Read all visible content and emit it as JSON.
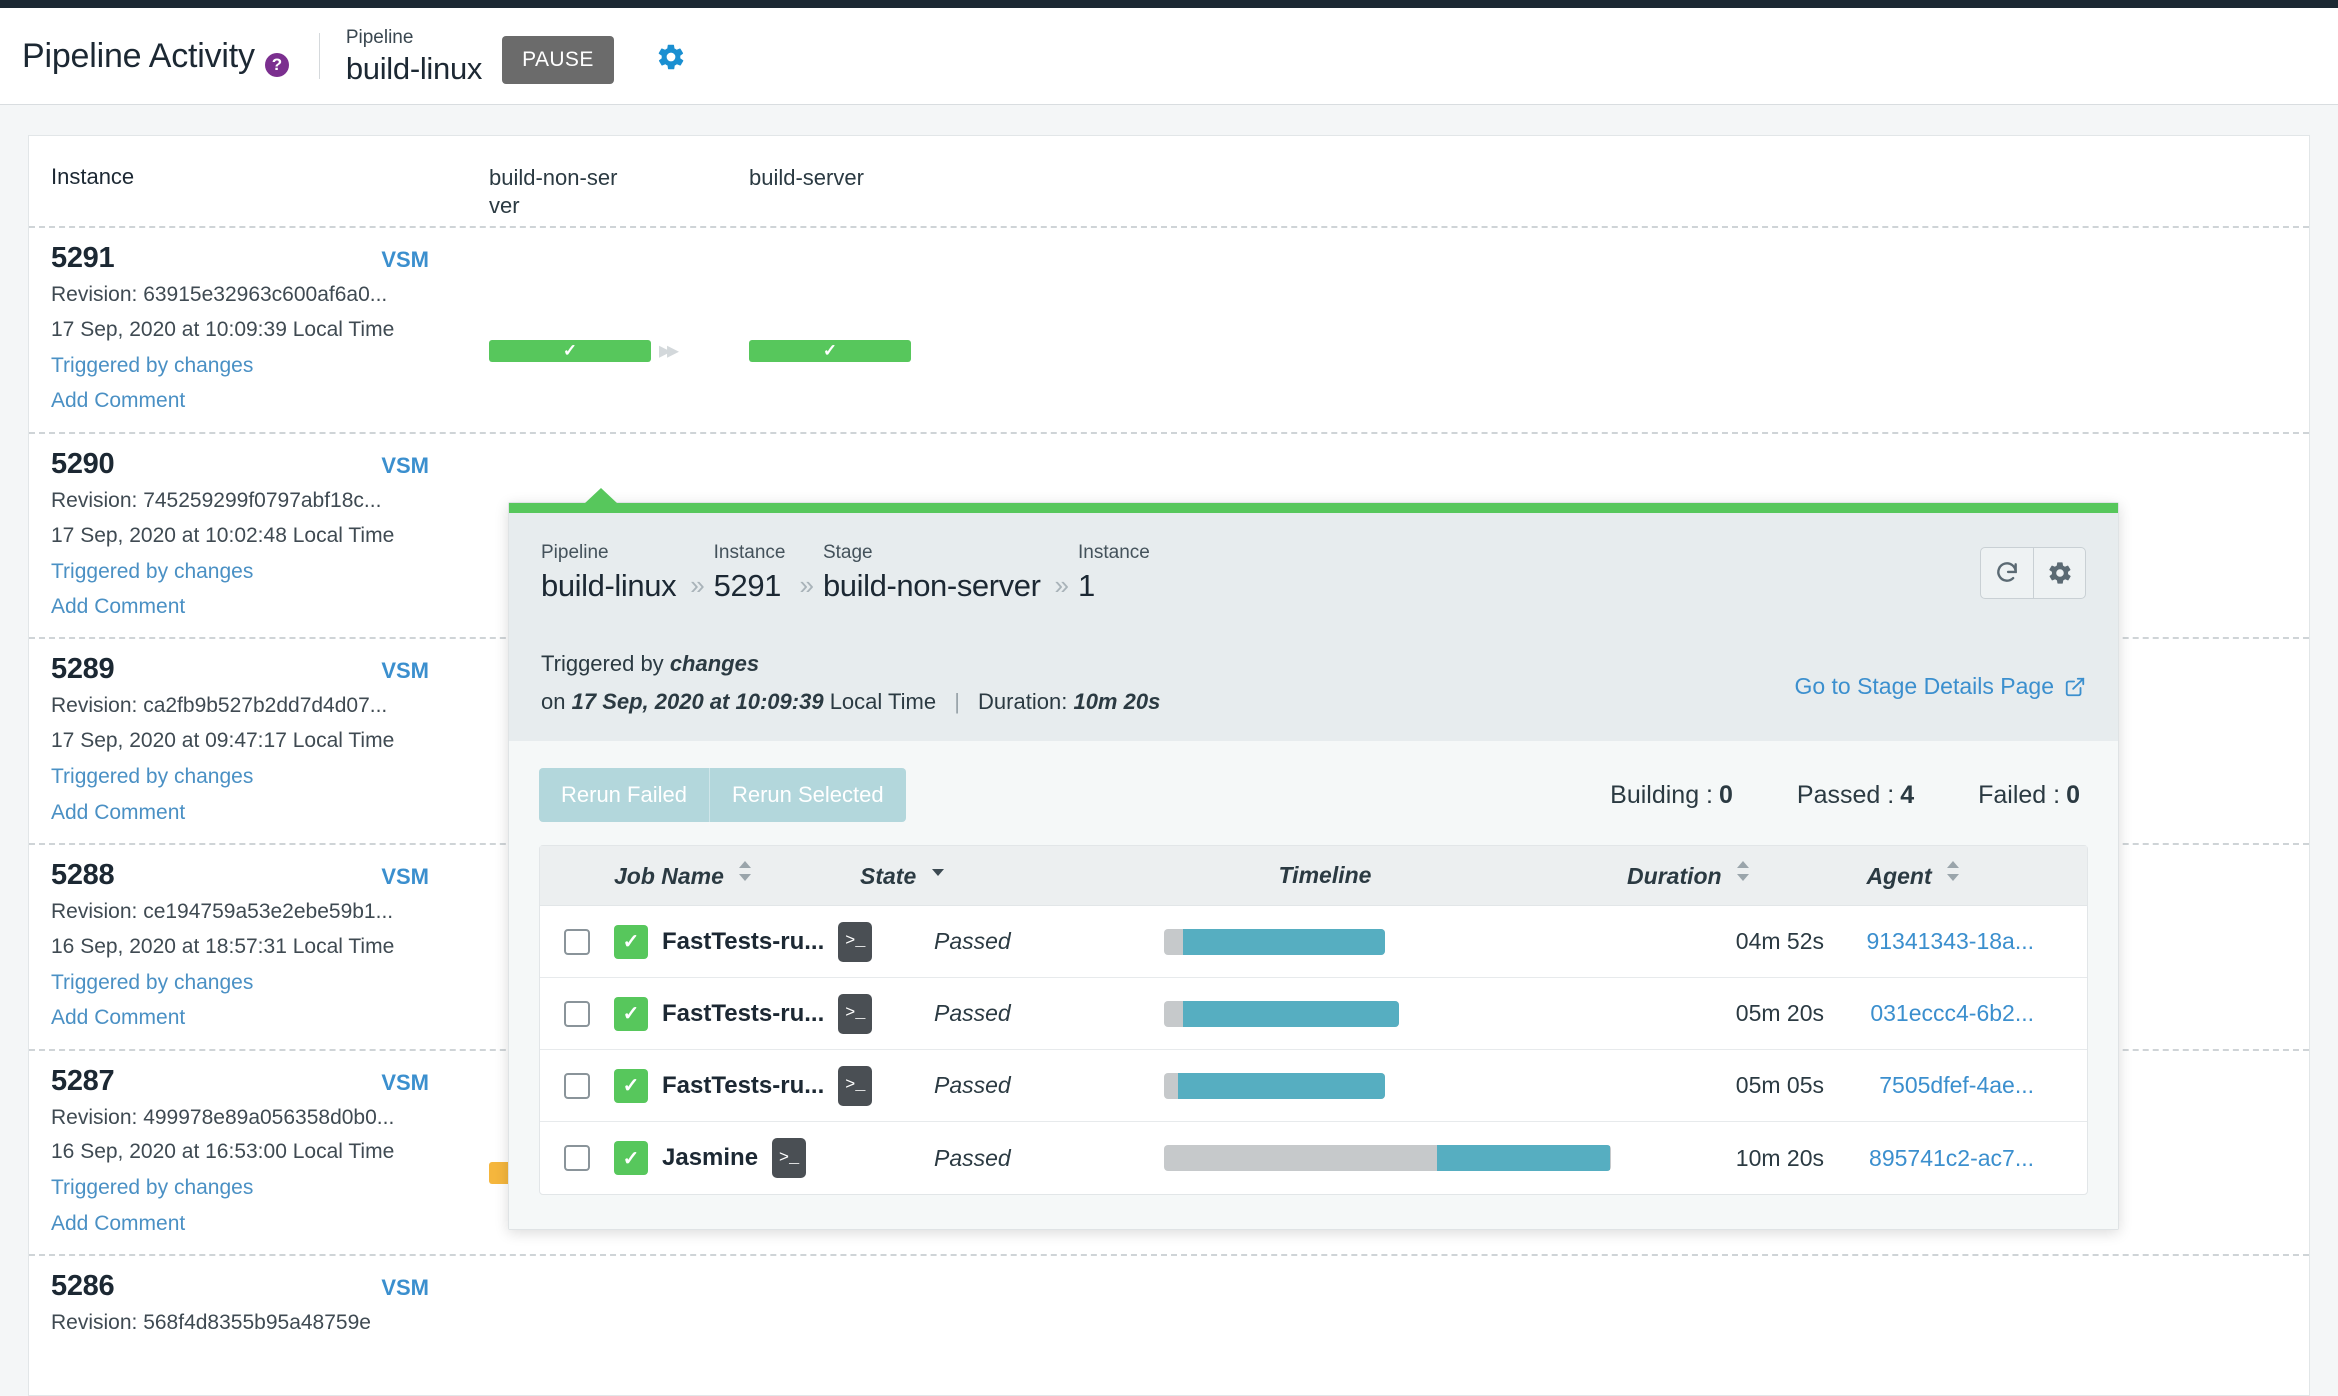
{
  "header": {
    "title": "Pipeline Activity",
    "help_icon": "help-icon",
    "pipeline_label": "Pipeline",
    "pipeline_name": "build-linux",
    "pause_label": "PAUSE",
    "gear_icon": "gear-icon"
  },
  "grid": {
    "instance_column": "Instance",
    "stages": [
      "build-non-ser\nver",
      "build-server"
    ]
  },
  "instances": [
    {
      "id": "5291",
      "vsm": "VSM",
      "revision": "Revision: 63915e32963c600af6a0...",
      "timestamp": "17 Sep, 2020 at 10:09:39 Local Time",
      "triggered": "Triggered by changes",
      "comment": "Add Comment",
      "stages": [
        {
          "name": "build-non-server",
          "status": "passed"
        },
        {
          "name": "build-server",
          "status": "passed"
        }
      ]
    },
    {
      "id": "5290",
      "vsm": "VSM",
      "revision": "Revision: 745259299f0797abf18c...",
      "timestamp": "17 Sep, 2020 at 10:02:48 Local Time",
      "triggered": "Triggered by changes",
      "comment": "Add Comment",
      "stages": []
    },
    {
      "id": "5289",
      "vsm": "VSM",
      "revision": "Revision: ca2fb9b527b2dd7d4d07...",
      "timestamp": "17 Sep, 2020 at 09:47:17 Local Time",
      "triggered": "Triggered by changes",
      "comment": "Add Comment",
      "stages": []
    },
    {
      "id": "5288",
      "vsm": "VSM",
      "revision": "Revision: ce194759a53e2ebe59b1...",
      "timestamp": "16 Sep, 2020 at 18:57:31 Local Time",
      "triggered": "Triggered by changes",
      "comment": "Add Comment",
      "stages": []
    },
    {
      "id": "5287",
      "vsm": "VSM",
      "revision": "Revision: 499978e89a056358d0b0...",
      "timestamp": "16 Sep, 2020 at 16:53:00 Local Time",
      "triggered": "Triggered by changes",
      "comment": "Add Comment",
      "stages": [
        {
          "name": "build-non-server",
          "status": "warning"
        }
      ]
    },
    {
      "id": "5286",
      "vsm": "VSM",
      "revision": "Revision: 568f4d8355b95a48759e",
      "timestamp": "",
      "triggered": "",
      "comment": "",
      "stages": []
    }
  ],
  "popup": {
    "breadcrumb": [
      {
        "label": "Pipeline",
        "value": "build-linux"
      },
      {
        "label": "Instance",
        "value": "5291"
      },
      {
        "label": "Stage",
        "value": "build-non-server"
      },
      {
        "label": "Instance",
        "value": "1"
      }
    ],
    "separator": "»",
    "refresh_icon": "refresh-icon",
    "settings_icon": "gear-icon",
    "triggered_by_prefix": "Triggered by",
    "triggered_by_value": "changes",
    "on_prefix": "on",
    "on_value": "17 Sep, 2020 at 10:09:39",
    "on_suffix": "Local Time",
    "duration_label": "Duration:",
    "duration_value": "10m 20s",
    "details_link": "Go to Stage Details Page",
    "external_icon": "external-link-icon",
    "rerun_failed": "Rerun Failed",
    "rerun_selected": "Rerun Selected",
    "counters": [
      {
        "label": "Building :",
        "value": "0"
      },
      {
        "label": "Passed :",
        "value": "4"
      },
      {
        "label": "Failed :",
        "value": "0"
      }
    ],
    "table": {
      "headers": [
        "Job Name",
        "State",
        "Timeline",
        "Duration",
        "Agent"
      ],
      "sorted_column": "State",
      "rows": [
        {
          "checkbox": false,
          "status": "passed",
          "name": "FastTests-ru...",
          "console_icon": "terminal-icon",
          "state": "Passed",
          "timeline_wait_pct": 4,
          "timeline_run_pct": 43,
          "duration": "04m 52s",
          "agent": "91341343-18a..."
        },
        {
          "checkbox": false,
          "status": "passed",
          "name": "FastTests-ru...",
          "console_icon": "terminal-icon",
          "state": "Passed",
          "timeline_wait_pct": 4,
          "timeline_run_pct": 46,
          "duration": "05m 20s",
          "agent": "031eccc4-6b2..."
        },
        {
          "checkbox": false,
          "status": "passed",
          "name": "FastTests-ru...",
          "console_icon": "terminal-icon",
          "state": "Passed",
          "timeline_wait_pct": 3,
          "timeline_run_pct": 44,
          "duration": "05m 05s",
          "agent": "7505dfef-4ae..."
        },
        {
          "checkbox": false,
          "status": "passed",
          "name": "Jasmine",
          "console_icon": "terminal-icon",
          "state": "Passed",
          "timeline_wait_pct": 58,
          "timeline_run_pct": 37,
          "duration": "10m 20s",
          "agent": "895741c2-ac7..."
        }
      ]
    }
  },
  "colors": {
    "pass_green": "#57c75c",
    "timeline_teal": "#56aec1",
    "timeline_gray": "#c6c9cb",
    "link_blue": "#3b8fce",
    "warning_orange": "#f5b63d",
    "popup_head_bg": "#e7ecee"
  }
}
